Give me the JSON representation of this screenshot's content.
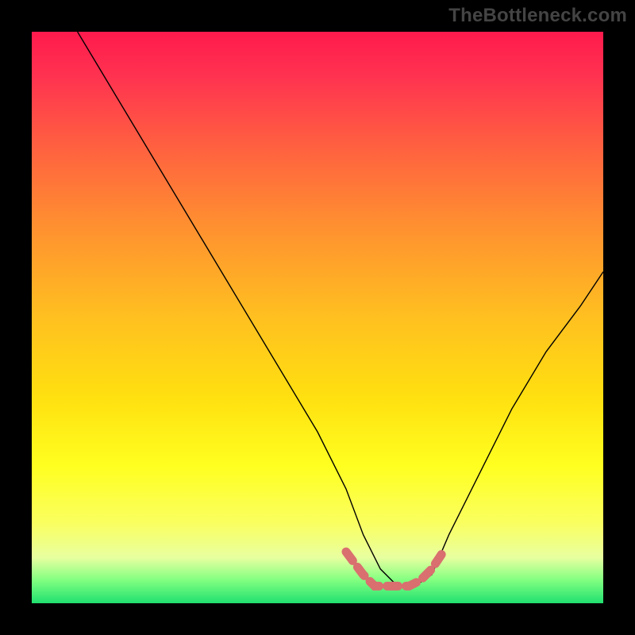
{
  "watermark": "TheBottleneck.com",
  "chart_data": {
    "type": "line",
    "title": "",
    "xlabel": "",
    "ylabel": "",
    "xlim": [
      0,
      100
    ],
    "ylim": [
      0,
      100
    ],
    "grid": false,
    "series": [
      {
        "name": "bottleneck-curve",
        "x": [
          8,
          14,
          20,
          26,
          32,
          38,
          44,
          50,
          55,
          58,
          61,
          64,
          67,
          70,
          73,
          78,
          84,
          90,
          96,
          100
        ],
        "y": [
          100,
          90,
          80,
          70,
          60,
          50,
          40,
          30,
          20,
          12,
          6,
          3,
          3,
          5,
          12,
          22,
          34,
          44,
          52,
          58
        ]
      },
      {
        "name": "confidence-band",
        "x": [
          55,
          58,
          60,
          62,
          64,
          66,
          68,
          70,
          72
        ],
        "y": [
          9,
          5,
          3,
          3,
          3,
          3,
          4,
          6,
          9
        ]
      }
    ],
    "colors": {
      "curve": "#000000",
      "band": "#d96f6f",
      "gradient_top": "#ff1a4d",
      "gradient_bottom": "#20e070"
    }
  }
}
